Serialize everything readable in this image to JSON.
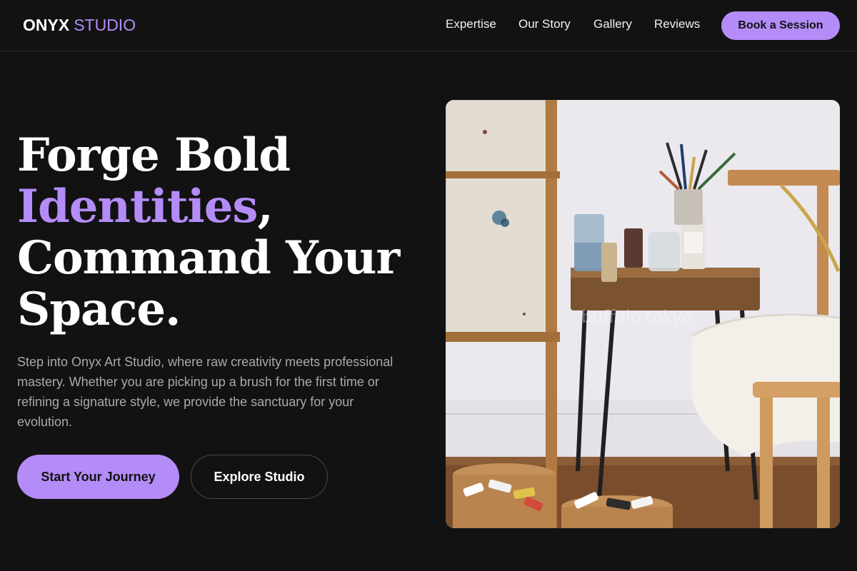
{
  "brand": {
    "name": "ONYX",
    "accent": "STUDIO"
  },
  "nav": {
    "links": [
      "Expertise",
      "Our Story",
      "Gallery",
      "Reviews"
    ],
    "cta": "Book a Session"
  },
  "hero": {
    "headline_line1": "Forge Bold",
    "headline_accent": "Identities",
    "headline_comma": ",",
    "headline_line3": "Command Your",
    "headline_line4": "Space.",
    "description": "Step into Onyx Art Studio, where raw creativity meets professional mastery. Whether you are picking up a brush for the first time or refining a signature style, we provide the sanctuary for your evolution.",
    "primary_button": "Start Your Journey",
    "secondary_button": "Explore Studio",
    "image_watermark": "buffalo.tokyo"
  },
  "colors": {
    "background": "#121212",
    "accent": "#b48cf7",
    "text": "#ffffff",
    "muted_text": "#a8a8b0"
  }
}
